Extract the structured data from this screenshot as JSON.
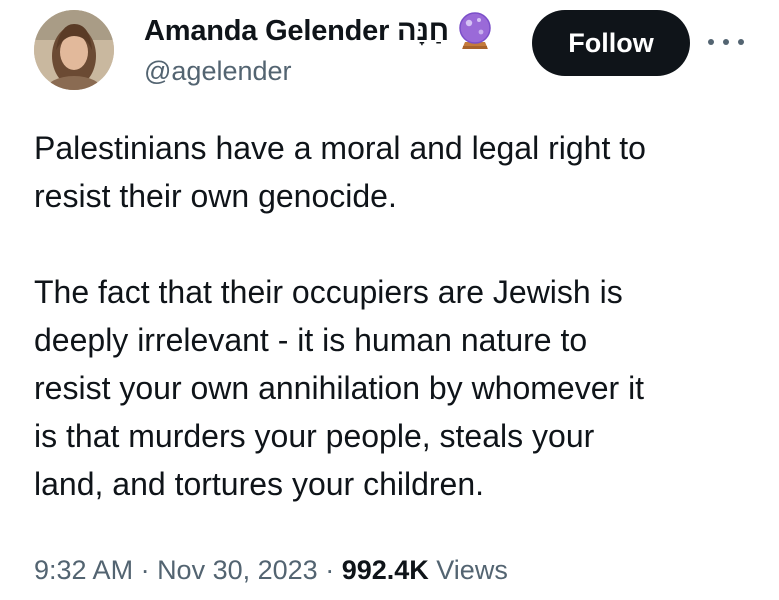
{
  "author": {
    "display_name": "Amanda Gelender חַנָּה",
    "handle": "@agelender",
    "badge_icon": "crystal-ball-icon"
  },
  "actions": {
    "follow_label": "Follow",
    "more_icon": "more-horizontal-icon"
  },
  "tweet": {
    "paragraph_1": "Palestinians have a moral and legal right to\nresist their own genocide.",
    "paragraph_2": "The fact that their occupiers are Jewish is\ndeeply irrelevant - it is human nature to\nresist your own annihilation by whomever it\nis that murders your people, steals your\nland, and tortures your children."
  },
  "meta": {
    "time": "9:32 AM",
    "separator": " · ",
    "date": "Nov 30, 2023",
    "views_count": "992.4K",
    "views_label": "Views"
  },
  "colors": {
    "text_primary": "#0f1419",
    "text_secondary": "#536471",
    "button_bg": "#0f1419",
    "button_text": "#ffffff",
    "badge_purple": "#7b4fc9"
  }
}
